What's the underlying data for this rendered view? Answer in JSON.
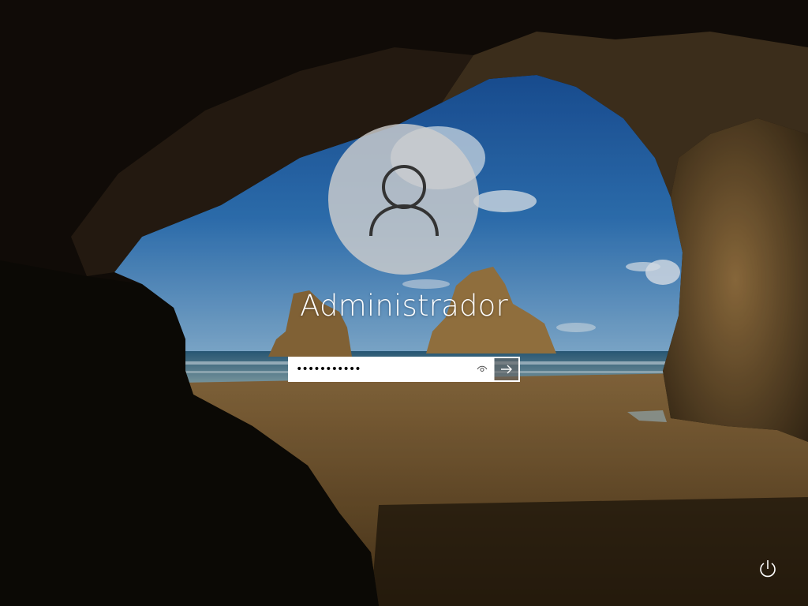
{
  "lock_screen": {
    "user": {
      "name": "Administrador",
      "avatar_icon": "user-silhouette-icon"
    },
    "password": {
      "value": "•••••••••••",
      "reveal_icon": "eye-icon",
      "submit_icon": "arrow-right-icon"
    },
    "bottom_right": {
      "power_icon": "power-icon"
    }
  },
  "colors": {
    "text": "#ffffff",
    "avatar_bg": "#cdcdcd",
    "input_bg": "#ffffff"
  }
}
